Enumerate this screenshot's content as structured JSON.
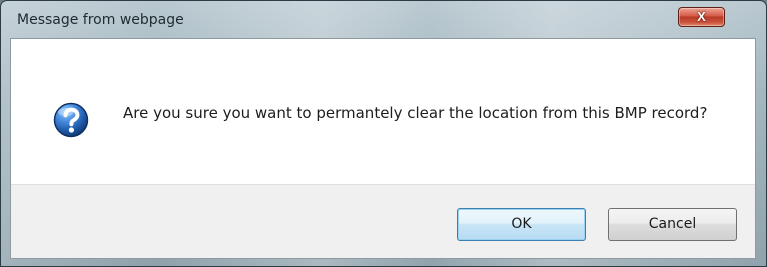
{
  "window": {
    "title": "Message from webpage",
    "close_symbol": "X"
  },
  "message": {
    "icon": "question-icon",
    "text": "Are you sure you want to permantely clear the location from this BMP record?"
  },
  "buttons": {
    "ok_label": "OK",
    "cancel_label": "Cancel"
  },
  "colors": {
    "question_icon": "#245fb0",
    "close_button": "#c9503a",
    "default_button_border": "#3c7fb1"
  }
}
